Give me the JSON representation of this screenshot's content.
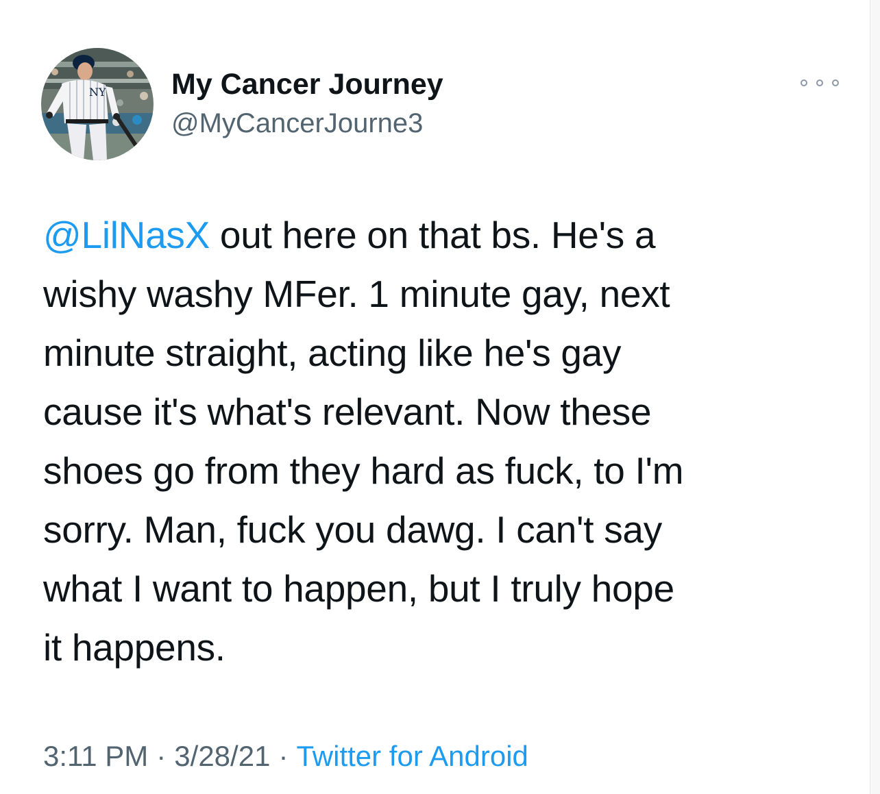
{
  "tweet": {
    "display_name": "My Cancer Journey",
    "handle": "@MyCancerJourne3",
    "avatar_icon": "baseball-player-avatar",
    "more_icon": "ellipsis-icon",
    "mention": "@LilNasX",
    "body_line_1_rest": " out here on that bs. He's a",
    "body_lines": [
      "wishy washy MFer. 1 minute gay, next",
      "minute straight, acting like he's gay",
      "cause it's what's relevant. Now these",
      "shoes go from they hard as fuck, to I'm",
      "sorry. Man, fuck you dawg. I can't say",
      "what I want to happen, but I truly hope",
      "it happens."
    ],
    "time": "3:11 PM",
    "separator": "·",
    "date": "3/28/21",
    "source": "Twitter for Android"
  },
  "colors": {
    "text": "#0f1419",
    "secondary": "#536471",
    "link": "#1d9bf0"
  }
}
